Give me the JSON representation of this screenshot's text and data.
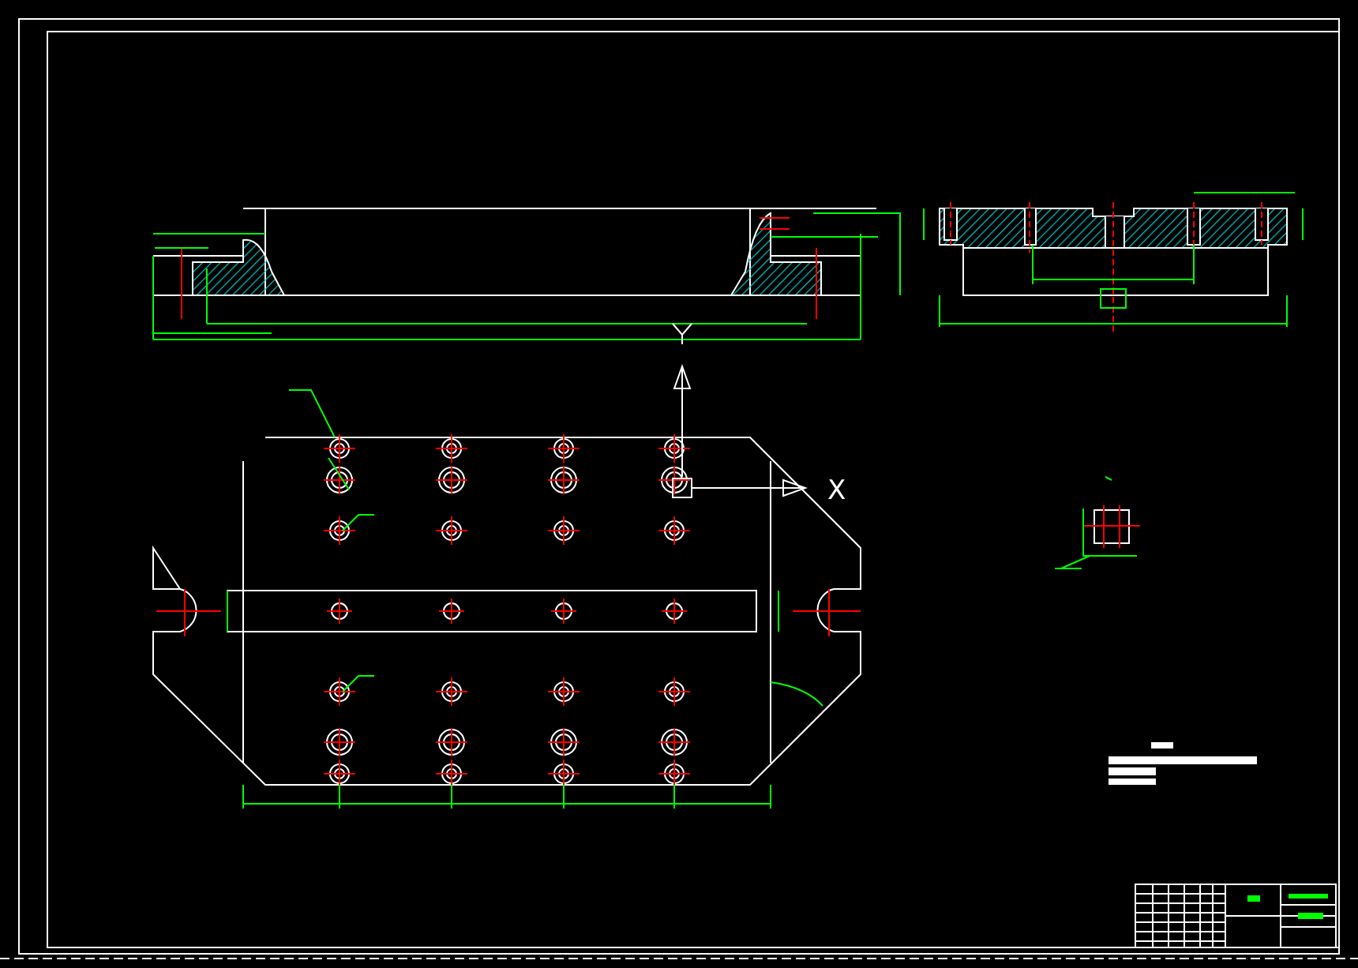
{
  "canvas": {
    "axis_label": "X"
  }
}
